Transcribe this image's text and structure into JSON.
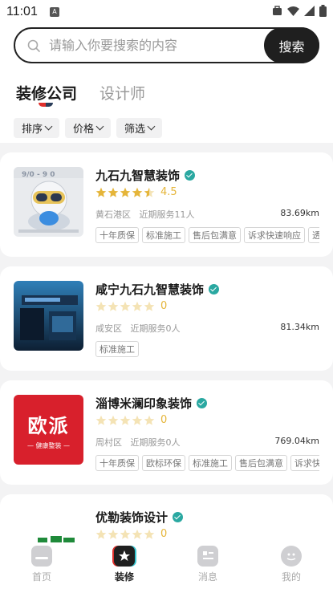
{
  "status_bar": {
    "time": "11:01"
  },
  "search": {
    "placeholder": "请输入你要搜索的内容",
    "button_label": "搜索"
  },
  "tabs": [
    {
      "label": "装修公司",
      "active": true
    },
    {
      "label": "设计师",
      "active": false
    }
  ],
  "filters": [
    {
      "label": "排序"
    },
    {
      "label": "价格"
    },
    {
      "label": "筛选"
    }
  ],
  "companies": [
    {
      "name": "九石九智慧装饰",
      "rating": "4.5",
      "stars_filled": 4.5,
      "district": "黄石港区",
      "service": "近期服务11人",
      "distance": "83.69km",
      "tags": [
        "十年质保",
        "标准施工",
        "售后包满意",
        "诉求快速响应",
        "透"
      ]
    },
    {
      "name": "咸宁九石九智慧装饰",
      "rating": "0",
      "stars_filled": 0,
      "district": "咸安区",
      "service": "近期服务0人",
      "distance": "81.34km",
      "tags": [
        "标准施工"
      ]
    },
    {
      "name": "淄博米澜印象装饰",
      "rating": "0",
      "stars_filled": 0,
      "district": "周村区",
      "service": "近期服务0人",
      "distance": "769.04km",
      "tags": [
        "十年质保",
        "欧标环保",
        "标准施工",
        "售后包满意",
        "诉求快速响应"
      ],
      "logo_text": "欧派",
      "logo_sub": "— 健康整装 —"
    },
    {
      "name": "优勒装饰设计",
      "rating": "0",
      "stars_filled": 0,
      "district": "",
      "service": "",
      "distance": "",
      "tags": []
    }
  ],
  "nav": [
    {
      "label": "首页",
      "icon": "home-icon",
      "active": false
    },
    {
      "label": "装修",
      "icon": "decoration-icon",
      "active": true
    },
    {
      "label": "消息",
      "icon": "message-icon",
      "active": false
    },
    {
      "label": "我的",
      "icon": "profile-icon",
      "active": false
    }
  ],
  "colors": {
    "star": "#e5b53a",
    "star_empty": "#f4e3b5",
    "verified": "#2aa8a1",
    "accent_red": "#d8202c"
  }
}
